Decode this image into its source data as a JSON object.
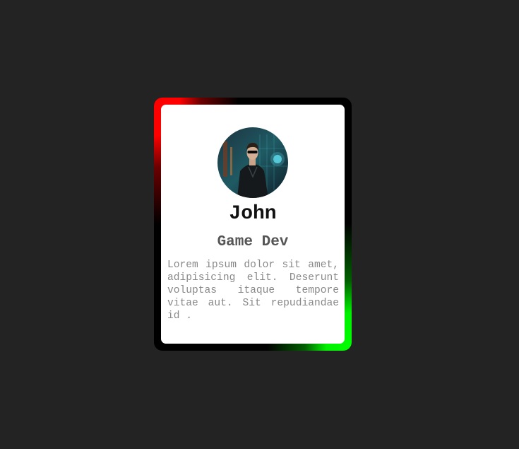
{
  "profile": {
    "name": "John",
    "role": "Game Dev",
    "bio": "Lorem ipsum dolor sit amet, adipisicing elit. Deserunt voluptas itaque tempore vitae aut. Sit repudiandae id ."
  },
  "colors": {
    "background": "#232323",
    "frame": "#000000",
    "glow_top_left": "#ff0000",
    "glow_bottom_right": "#00ff00",
    "card": "#ffffff"
  }
}
